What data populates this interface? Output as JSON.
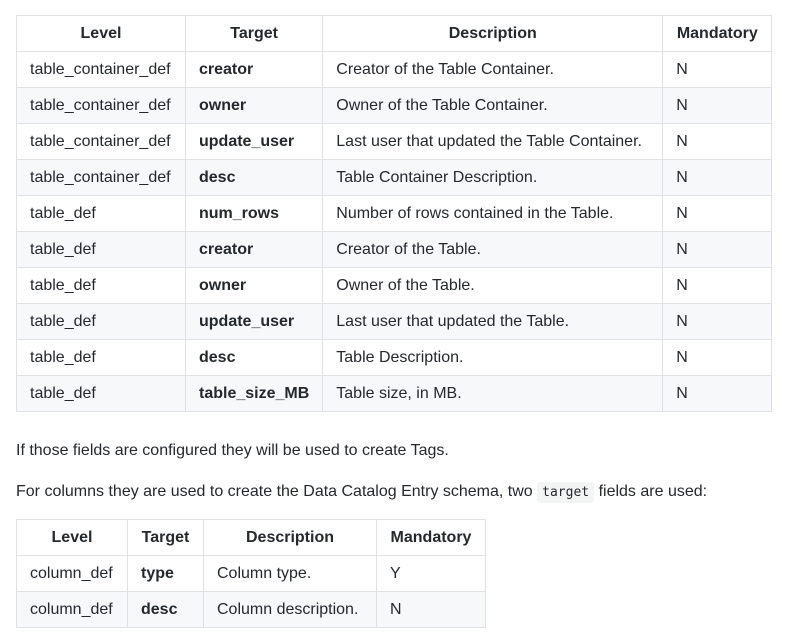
{
  "table1": {
    "headers": [
      "Level",
      "Target",
      "Description",
      "Mandatory"
    ],
    "rows": [
      [
        "table_container_def",
        "creator",
        "Creator of the Table Container.",
        "N"
      ],
      [
        "table_container_def",
        "owner",
        "Owner of the Table Container.",
        "N"
      ],
      [
        "table_container_def",
        "update_user",
        "Last user that updated the Table Container.",
        "N"
      ],
      [
        "table_container_def",
        "desc",
        "Table Container Description.",
        "N"
      ],
      [
        "table_def",
        "num_rows",
        "Number of rows contained in the Table.",
        "N"
      ],
      [
        "table_def",
        "creator",
        "Creator of the Table.",
        "N"
      ],
      [
        "table_def",
        "owner",
        "Owner of the Table.",
        "N"
      ],
      [
        "table_def",
        "update_user",
        "Last user that updated the Table.",
        "N"
      ],
      [
        "table_def",
        "desc",
        "Table Description.",
        "N"
      ],
      [
        "table_def",
        "table_size_MB",
        "Table size, in MB.",
        "N"
      ]
    ]
  },
  "paragraph1": "If those fields are configured they will be used to create Tags.",
  "paragraph2": {
    "before": "For columns they are used to create the Data Catalog Entry schema, two",
    "code": "target",
    "after": "fields are used:"
  },
  "table2": {
    "headers": [
      "Level",
      "Target",
      "Description",
      "Mandatory"
    ],
    "rows": [
      [
        "column_def",
        "type",
        "Column type.",
        "Y"
      ],
      [
        "column_def",
        "desc",
        "Column description.",
        "N"
      ]
    ]
  }
}
